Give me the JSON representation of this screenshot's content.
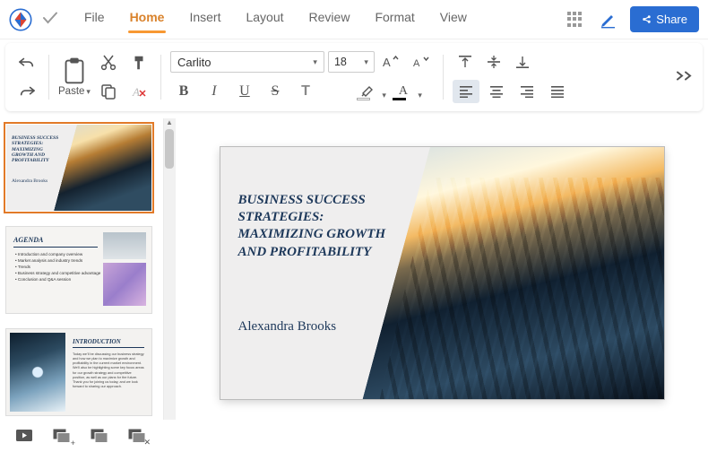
{
  "menu": {
    "file": "File",
    "home": "Home",
    "insert": "Insert",
    "layout": "Layout",
    "review": "Review",
    "format": "Format",
    "view": "View"
  },
  "share": {
    "label": "Share"
  },
  "toolbar": {
    "paste": "Paste"
  },
  "font": {
    "name": "Carlito",
    "size": "18"
  },
  "slide": {
    "title": "BUSINESS SUCCESS STRATEGIES: MAXIMIZING GROWTH AND PROFITABILITY",
    "author": "Alexandra Brooks"
  },
  "thumbs": {
    "s1": {
      "title": "BUSINESS SUCCESS STRATEGIES: MAXIMIZING GROWTH AND PROFITABILITY",
      "author": "Alexandra Brooks"
    },
    "s2": {
      "title": "AGENDA",
      "items": [
        "Introduction and company overview",
        "Market analysis and industry trends",
        "Trends",
        "Business strategy and competitive advantage",
        "Conclusion and Q&A session"
      ]
    },
    "s3": {
      "title": "INTRODUCTION",
      "body": "Today we'll be discussing our business strategy and how we plan to maximize growth and profitability in the current market environment. We'll also be highlighting some key focus areas for our growth strategy and competitive position, as well as our plans for the future. Thank you for joining us today, and we look forward to sharing our approach."
    }
  }
}
